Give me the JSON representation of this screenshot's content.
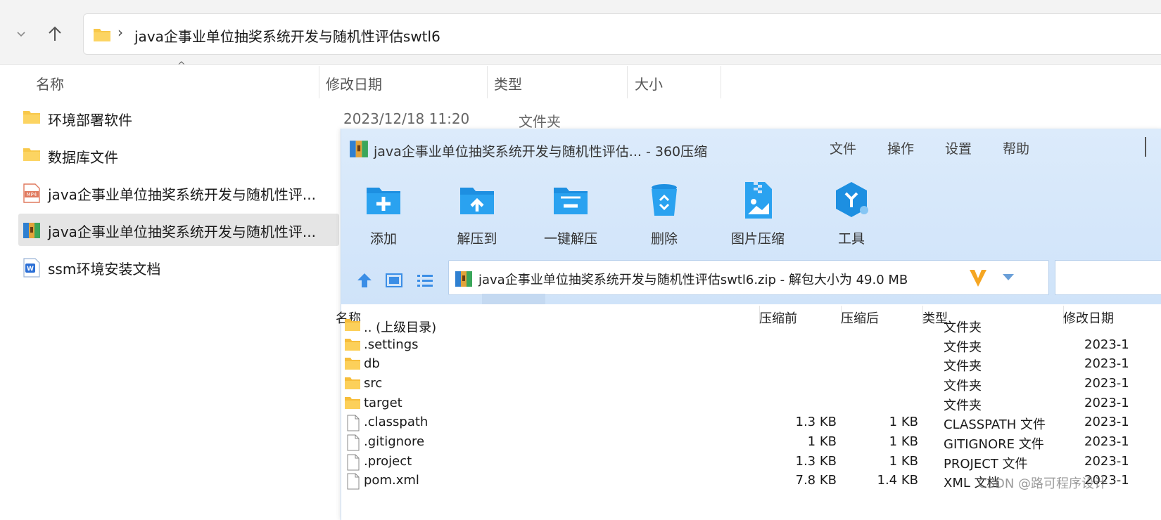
{
  "explorer": {
    "address_path": "java企事业单位抽奖系统开发与随机性评估swtl6",
    "columns": {
      "name": "名称",
      "modified": "修改日期",
      "type": "类型",
      "size": "大小"
    },
    "first_row_date": "2023/12/18 11:20",
    "first_row_type": "文件夹",
    "items": [
      {
        "name": "环境部署软件",
        "icon": "folder-icon"
      },
      {
        "name": "数据库文件",
        "icon": "folder-icon"
      },
      {
        "name": "java企事业单位抽奖系统开发与随机性评...",
        "icon": "mp4-file-icon"
      },
      {
        "name": "java企事业单位抽奖系统开发与随机性评...",
        "icon": "zip-archive-icon"
      },
      {
        "name": "ssm环境安装文档",
        "icon": "word-doc-icon"
      }
    ]
  },
  "zip": {
    "title": "java企事业单位抽奖系统开发与随机性评估... - 360压缩",
    "menu": [
      "文件",
      "操作",
      "设置",
      "帮助"
    ],
    "toolbar": [
      "添加",
      "解压到",
      "一键解压",
      "删除",
      "图片压缩",
      "工具"
    ],
    "path_text": "java企事业单位抽奖系统开发与随机性评估swtl6.zip - 解包大小为 49.0 MB",
    "columns": {
      "name": "名称",
      "before": "压缩前",
      "after": "压缩后",
      "type": "类型",
      "modified": "修改日期"
    },
    "rows": [
      {
        "name": ".. (上级目录)",
        "before": "",
        "after": "",
        "type": "文件夹",
        "date": ""
      },
      {
        "name": ".settings",
        "before": "",
        "after": "",
        "type": "文件夹",
        "date": "2023-1"
      },
      {
        "name": "db",
        "before": "",
        "after": "",
        "type": "文件夹",
        "date": "2023-1"
      },
      {
        "name": "src",
        "before": "",
        "after": "",
        "type": "文件夹",
        "date": "2023-1"
      },
      {
        "name": "target",
        "before": "",
        "after": "",
        "type": "文件夹",
        "date": "2023-1"
      },
      {
        "name": ".classpath",
        "before": "1.3 KB",
        "after": "1 KB",
        "type": "CLASSPATH 文件",
        "date": "2023-1"
      },
      {
        "name": ".gitignore",
        "before": "1 KB",
        "after": "1 KB",
        "type": "GITIGNORE 文件",
        "date": "2023-1"
      },
      {
        "name": ".project",
        "before": "1.3 KB",
        "after": "1 KB",
        "type": "PROJECT 文件",
        "date": "2023-1"
      },
      {
        "name": "pom.xml",
        "before": "7.8 KB",
        "after": "1.4 KB",
        "type": "XML 文档",
        "date": "2023-1"
      }
    ]
  },
  "watermark": "CSDN @路可程序设计"
}
